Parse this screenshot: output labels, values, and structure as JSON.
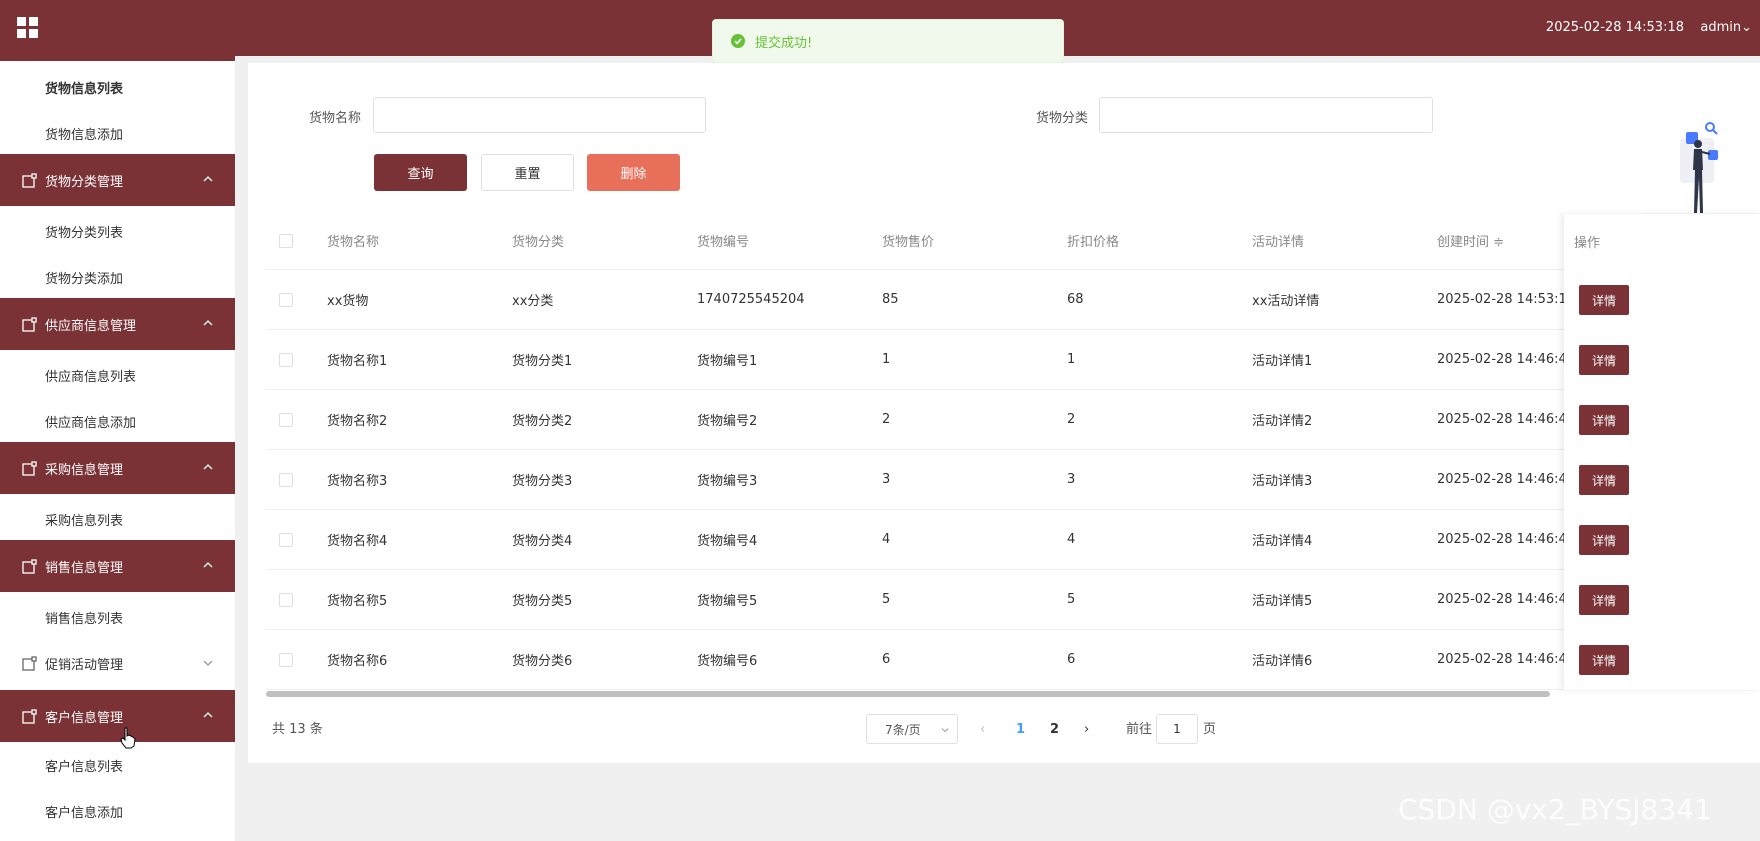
{
  "topbar": {
    "datetime": "2025-02-28 14:53:18",
    "user": "admin"
  },
  "toast": {
    "message": "提交成功!"
  },
  "sidebar": {
    "items": [
      {
        "type": "sub",
        "label": "货物信息列表",
        "bold": true
      },
      {
        "type": "sub",
        "label": "货物信息添加"
      },
      {
        "type": "group",
        "label": "货物分类管理",
        "expanded": true
      },
      {
        "type": "sub",
        "label": "货物分类列表"
      },
      {
        "type": "sub",
        "label": "货物分类添加"
      },
      {
        "type": "group",
        "label": "供应商信息管理",
        "expanded": true
      },
      {
        "type": "sub",
        "label": "供应商信息列表"
      },
      {
        "type": "sub",
        "label": "供应商信息添加"
      },
      {
        "type": "group",
        "label": "采购信息管理",
        "expanded": true
      },
      {
        "type": "sub",
        "label": "采购信息列表"
      },
      {
        "type": "group",
        "label": "销售信息管理",
        "expanded": true
      },
      {
        "type": "sub",
        "label": "销售信息列表"
      },
      {
        "type": "group",
        "label": "促销活动管理",
        "expanded": false
      },
      {
        "type": "group",
        "label": "客户信息管理",
        "expanded": true
      },
      {
        "type": "sub",
        "label": "客户信息列表"
      },
      {
        "type": "sub",
        "label": "客户信息添加"
      }
    ]
  },
  "search": {
    "name_label": "货物名称",
    "name_value": "",
    "category_label": "货物分类",
    "category_value": "",
    "query_label": "查询",
    "reset_label": "重置",
    "delete_label": "删除"
  },
  "table": {
    "columns": [
      "货物名称",
      "货物分类",
      "货物编号",
      "货物售价",
      "折扣价格",
      "活动详情",
      "创建时间 ≑"
    ],
    "op_header": "操作",
    "detail_label": "详情",
    "rows": [
      [
        "xx货物",
        "xx分类",
        "1740725545204",
        "85",
        "68",
        "xx活动详情",
        "2025-02-28 14:53:1"
      ],
      [
        "货物名称1",
        "货物分类1",
        "货物编号1",
        "1",
        "1",
        "活动详情1",
        "2025-02-28 14:46:4"
      ],
      [
        "货物名称2",
        "货物分类2",
        "货物编号2",
        "2",
        "2",
        "活动详情2",
        "2025-02-28 14:46:4"
      ],
      [
        "货物名称3",
        "货物分类3",
        "货物编号3",
        "3",
        "3",
        "活动详情3",
        "2025-02-28 14:46:4"
      ],
      [
        "货物名称4",
        "货物分类4",
        "货物编号4",
        "4",
        "4",
        "活动详情4",
        "2025-02-28 14:46:4"
      ],
      [
        "货物名称5",
        "货物分类5",
        "货物编号5",
        "5",
        "5",
        "活动详情5",
        "2025-02-28 14:46:4"
      ],
      [
        "货物名称6",
        "货物分类6",
        "货物编号6",
        "6",
        "6",
        "活动详情6",
        "2025-02-28 14:46:4"
      ]
    ]
  },
  "pagination": {
    "total": "共 13 条",
    "page_size": "7条/页",
    "pages": [
      "1",
      "2"
    ],
    "current": "1",
    "goto_label": "前往",
    "goto_value": "1",
    "goto_unit": "页"
  },
  "watermark": "CSDN @vx2_BYSJ8341",
  "colors": {
    "primary": "#7a3236",
    "danger": "#e8705b",
    "success": "#67c23a",
    "link": "#409eff"
  }
}
